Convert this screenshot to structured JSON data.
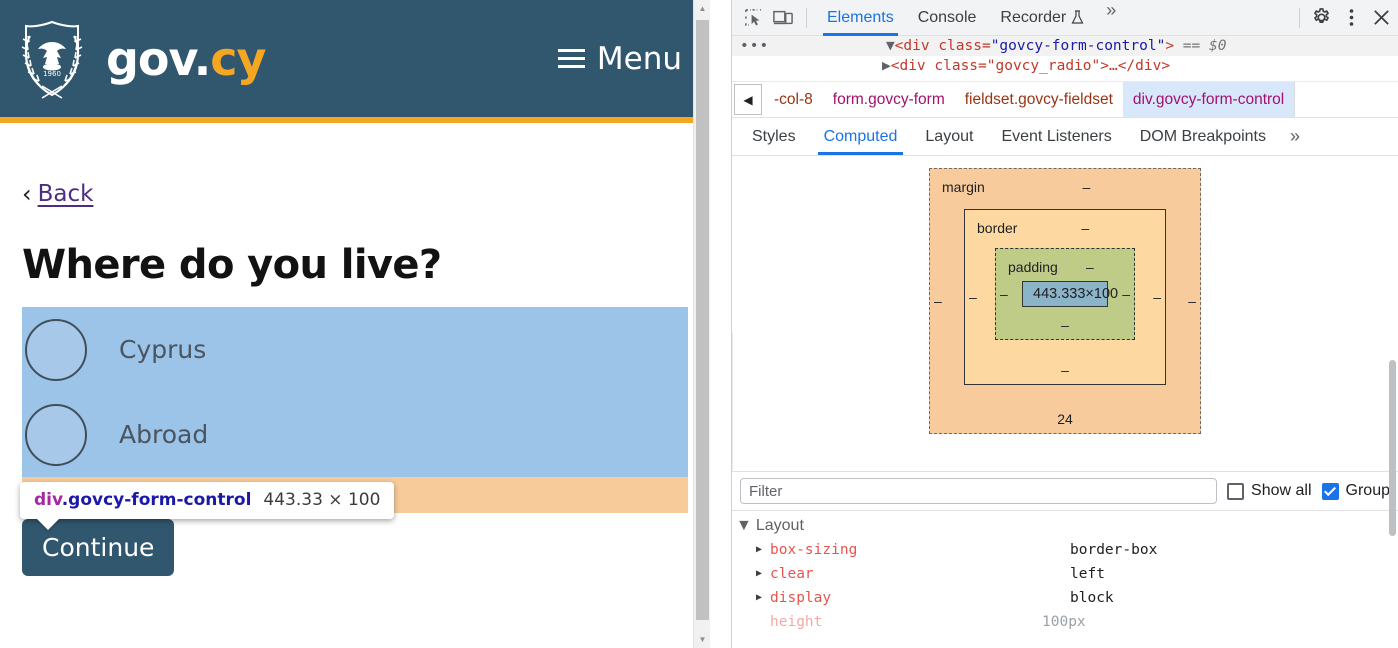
{
  "webpage": {
    "header": {
      "crest_icon": "cyprus-coat-of-arms",
      "wordmark_main": "gov",
      "wordmark_dot": ".",
      "wordmark_accent": "cy",
      "menu_label": "Menu",
      "menu_icon": "hamburger-icon",
      "bg_color": "#31576f",
      "accent_color": "#f5a623"
    },
    "back_link": {
      "chevron": "‹",
      "label": "Back"
    },
    "heading": "Where do you live?",
    "radio_options": [
      {
        "label": "Cyprus",
        "checked": false
      },
      {
        "label": "Abroad",
        "checked": false
      }
    ],
    "continue_button": "Continue",
    "inspect_tooltip": {
      "tag": "div",
      "class": ".govcy-form-control",
      "dimensions": "443.33 × 100"
    },
    "overlay_colors": {
      "content": "#9cc3e8",
      "margin": "#f7cb9a"
    }
  },
  "devtools": {
    "toolbar": {
      "inspect_icon": "inspect-element-icon",
      "device_icon": "device-toolbar-icon",
      "settings_icon": "gear-icon",
      "more_icon": "kebab-menu-icon",
      "close_icon": "close-icon",
      "overflow_icon": "»",
      "tabs": [
        {
          "label": "Elements",
          "active": true
        },
        {
          "label": "Console",
          "active": false
        },
        {
          "label": "Recorder",
          "active": false,
          "badge": "flask-icon"
        }
      ]
    },
    "dom": {
      "ellipsis": "•••",
      "row1": {
        "triangle": "▼",
        "open": "<div class=",
        "quote_open": "\"",
        "class_value": "govcy-form-control",
        "quote_close": "\"",
        "gt": ">",
        "selected_marker": "== $0"
      },
      "row2": {
        "triangle": "▶",
        "text": "<div class=\"govcy_radio\">…</div>"
      }
    },
    "breadcrumb": {
      "scroll_left_icon": "◀",
      "items": [
        {
          "label": "-col-8",
          "selected": false,
          "color": "orange"
        },
        {
          "label": "form.govcy-form",
          "selected": false,
          "color": "magenta"
        },
        {
          "label": "fieldset.govcy-fieldset",
          "selected": false,
          "color": "orange"
        },
        {
          "label": "div.govcy-form-control",
          "selected": true,
          "color": "magenta"
        }
      ]
    },
    "subtabs": [
      {
        "label": "Styles",
        "active": false
      },
      {
        "label": "Computed",
        "active": true
      },
      {
        "label": "Layout",
        "active": false
      },
      {
        "label": "Event Listeners",
        "active": false
      },
      {
        "label": "DOM Breakpoints",
        "active": false
      }
    ],
    "subtabs_overflow": "»",
    "box_model": {
      "margin_label": "margin",
      "margin_top": "–",
      "margin_left": "–",
      "margin_right": "–",
      "margin_bottom": "24",
      "border_label": "border",
      "border_top": "–",
      "border_left": "–",
      "border_right": "–",
      "border_bottom": "–",
      "padding_label": "padding",
      "padding_top": "–",
      "padding_left": "–",
      "padding_right": "–",
      "padding_bottom": "–",
      "content_size": "443.333×100",
      "colors": {
        "margin": "#f8cb9c",
        "border": "#fdd8a0",
        "padding": "#bfcc87",
        "content": "#8cb4c8"
      }
    },
    "filter": {
      "placeholder": "Filter",
      "value": "",
      "show_all_label": "Show all",
      "show_all_checked": false,
      "group_label": "Group",
      "group_checked": true
    },
    "computed": {
      "group_name": "Layout",
      "group_triangle": "▼",
      "properties": [
        {
          "name": "box-sizing",
          "value": "border-box",
          "expandable": true,
          "inherited": false
        },
        {
          "name": "clear",
          "value": "left",
          "expandable": true,
          "inherited": false
        },
        {
          "name": "display",
          "value": "block",
          "expandable": true,
          "inherited": false
        },
        {
          "name": "height",
          "value": "100px",
          "expandable": false,
          "inherited": true
        }
      ]
    }
  }
}
